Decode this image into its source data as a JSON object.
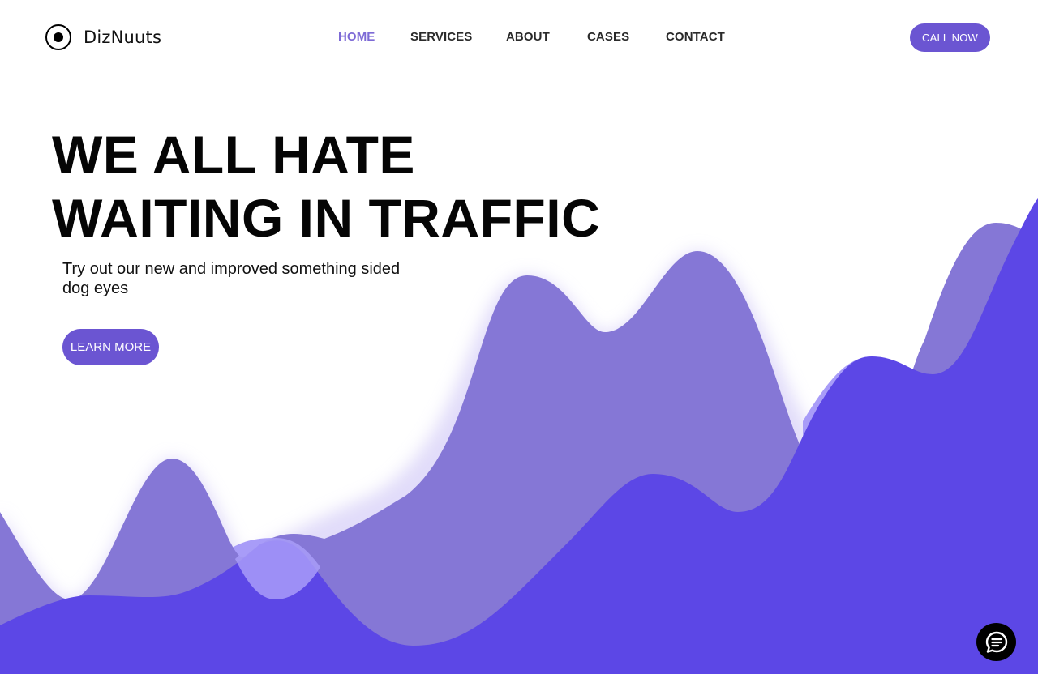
{
  "brand": {
    "name": "DizNuuts",
    "logo_icon": "target-dot-icon"
  },
  "nav": {
    "items": [
      {
        "label": "HOME",
        "active": true
      },
      {
        "label": "SERVICES",
        "active": false
      },
      {
        "label": "ABOUT",
        "active": false
      },
      {
        "label": "CASES",
        "active": false
      },
      {
        "label": "CONTACT",
        "active": false
      }
    ],
    "cta_label": "CALL NOW"
  },
  "hero": {
    "title_line1": "WE ALL HATE",
    "title_line2": "WAITING IN TRAFFIC",
    "subtitle": "Try out our new and improved something sided dog eyes",
    "button_label": "LEARN MORE"
  },
  "chat": {
    "icon": "chat-bubble-icon"
  },
  "colors": {
    "accent": "#6b55d2",
    "nav_active": "#7d6ad6",
    "wave_front": "#5c47e6",
    "wave_mid": "#8577d6",
    "wave_light": "#a89cf8",
    "text": "#050505",
    "background": "#ffffff"
  }
}
